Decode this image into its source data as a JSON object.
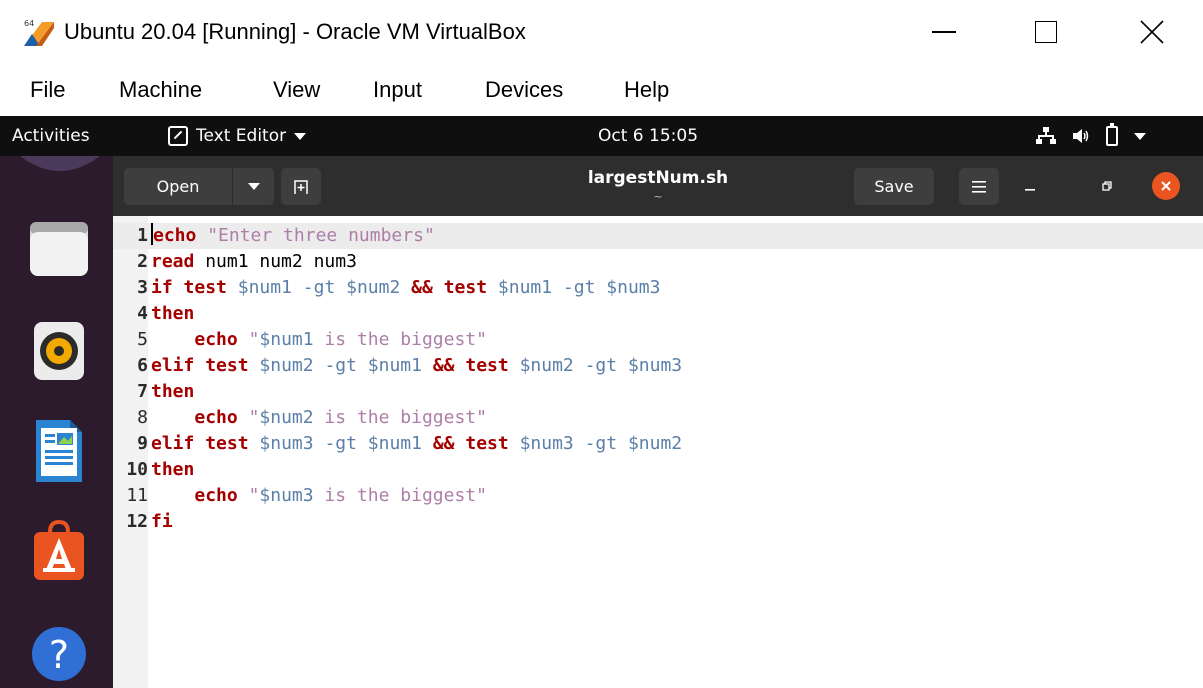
{
  "window": {
    "title": "Ubuntu 20.04 [Running] - Oracle VM VirtualBox",
    "logo_icon": "virtualbox-icon",
    "controls": [
      "minimize-icon",
      "maximize-icon",
      "close-icon"
    ]
  },
  "vbox_menu": {
    "items": [
      "File",
      "Machine",
      "View",
      "Input",
      "Devices",
      "Help"
    ]
  },
  "topbar": {
    "activities": "Activities",
    "app_name": "Text Editor",
    "clock": "Oct 6  15:05",
    "status_icons": [
      "network-icon",
      "volume-icon",
      "battery-icon",
      "system-menu-arrow-icon"
    ]
  },
  "dock": {
    "items": [
      {
        "name": "files",
        "icon": "files-icon",
        "color": "#efefef"
      },
      {
        "name": "rhythmbox",
        "icon": "rhythmbox-icon",
        "color": "#f2a900"
      },
      {
        "name": "libreoffice-writer",
        "icon": "writer-icon",
        "color": "#2a84d1"
      },
      {
        "name": "ubuntu-software",
        "icon": "software-icon",
        "color": "#e95420"
      },
      {
        "name": "help",
        "icon": "help-icon",
        "color": "#2f6fd6"
      }
    ]
  },
  "gedit": {
    "open_label": "Open",
    "save_label": "Save",
    "document_title": "largestNum.sh",
    "document_subtitle": "~",
    "accent": "#e95420"
  },
  "editor": {
    "colors": {
      "keyword": "#a40000",
      "string": "#ad7fa8",
      "variable": "#5b7fa8"
    },
    "lines": [
      {
        "n": "1",
        "tokens": [
          [
            "kw",
            "echo"
          ],
          [
            "t",
            " "
          ],
          [
            "str",
            "\"Enter three numbers\""
          ]
        ]
      },
      {
        "n": "2",
        "tokens": [
          [
            "kw",
            "read"
          ],
          [
            "t",
            " num1 num2 num3"
          ]
        ]
      },
      {
        "n": "3",
        "tokens": [
          [
            "kw",
            "if"
          ],
          [
            "t",
            " "
          ],
          [
            "kw",
            "test"
          ],
          [
            "t",
            " "
          ],
          [
            "var",
            "$num1"
          ],
          [
            "t",
            " "
          ],
          [
            "var",
            "-gt"
          ],
          [
            "t",
            " "
          ],
          [
            "var",
            "$num2"
          ],
          [
            "t",
            " "
          ],
          [
            "kw",
            "&&"
          ],
          [
            "t",
            " "
          ],
          [
            "kw",
            "test"
          ],
          [
            "t",
            " "
          ],
          [
            "var",
            "$num1"
          ],
          [
            "t",
            " "
          ],
          [
            "var",
            "-gt"
          ],
          [
            "t",
            " "
          ],
          [
            "var",
            "$num3"
          ]
        ]
      },
      {
        "n": "4",
        "tokens": [
          [
            "kw",
            "then"
          ]
        ]
      },
      {
        "n": "5",
        "tokens": [
          [
            "t",
            "    "
          ],
          [
            "kw",
            "echo"
          ],
          [
            "t",
            " "
          ],
          [
            "str",
            "\""
          ],
          [
            "var",
            "$num1"
          ],
          [
            "str",
            " is the biggest\""
          ]
        ]
      },
      {
        "n": "6",
        "tokens": [
          [
            "kw",
            "elif"
          ],
          [
            "t",
            " "
          ],
          [
            "kw",
            "test"
          ],
          [
            "t",
            " "
          ],
          [
            "var",
            "$num2"
          ],
          [
            "t",
            " "
          ],
          [
            "var",
            "-gt"
          ],
          [
            "t",
            " "
          ],
          [
            "var",
            "$num1"
          ],
          [
            "t",
            " "
          ],
          [
            "kw",
            "&&"
          ],
          [
            "t",
            " "
          ],
          [
            "kw",
            "test"
          ],
          [
            "t",
            " "
          ],
          [
            "var",
            "$num2"
          ],
          [
            "t",
            " "
          ],
          [
            "var",
            "-gt"
          ],
          [
            "t",
            " "
          ],
          [
            "var",
            "$num3"
          ]
        ]
      },
      {
        "n": "7",
        "tokens": [
          [
            "kw",
            "then"
          ]
        ]
      },
      {
        "n": "8",
        "tokens": [
          [
            "t",
            "    "
          ],
          [
            "kw",
            "echo"
          ],
          [
            "t",
            " "
          ],
          [
            "str",
            "\""
          ],
          [
            "var",
            "$num2"
          ],
          [
            "str",
            " is the biggest\""
          ]
        ]
      },
      {
        "n": "9",
        "tokens": [
          [
            "kw",
            "elif"
          ],
          [
            "t",
            " "
          ],
          [
            "kw",
            "test"
          ],
          [
            "t",
            " "
          ],
          [
            "var",
            "$num3"
          ],
          [
            "t",
            " "
          ],
          [
            "var",
            "-gt"
          ],
          [
            "t",
            " "
          ],
          [
            "var",
            "$num1"
          ],
          [
            "t",
            " "
          ],
          [
            "kw",
            "&&"
          ],
          [
            "t",
            " "
          ],
          [
            "kw",
            "test"
          ],
          [
            "t",
            " "
          ],
          [
            "var",
            "$num3"
          ],
          [
            "t",
            " "
          ],
          [
            "var",
            "-gt"
          ],
          [
            "t",
            " "
          ],
          [
            "var",
            "$num2"
          ]
        ]
      },
      {
        "n": "10",
        "tokens": [
          [
            "kw",
            "then"
          ]
        ]
      },
      {
        "n": "11",
        "tokens": [
          [
            "t",
            "    "
          ],
          [
            "kw",
            "echo"
          ],
          [
            "t",
            " "
          ],
          [
            "str",
            "\""
          ],
          [
            "var",
            "$num3"
          ],
          [
            "str",
            " is the biggest\""
          ]
        ]
      },
      {
        "n": "12",
        "tokens": [
          [
            "kw",
            "fi"
          ]
        ]
      }
    ]
  }
}
